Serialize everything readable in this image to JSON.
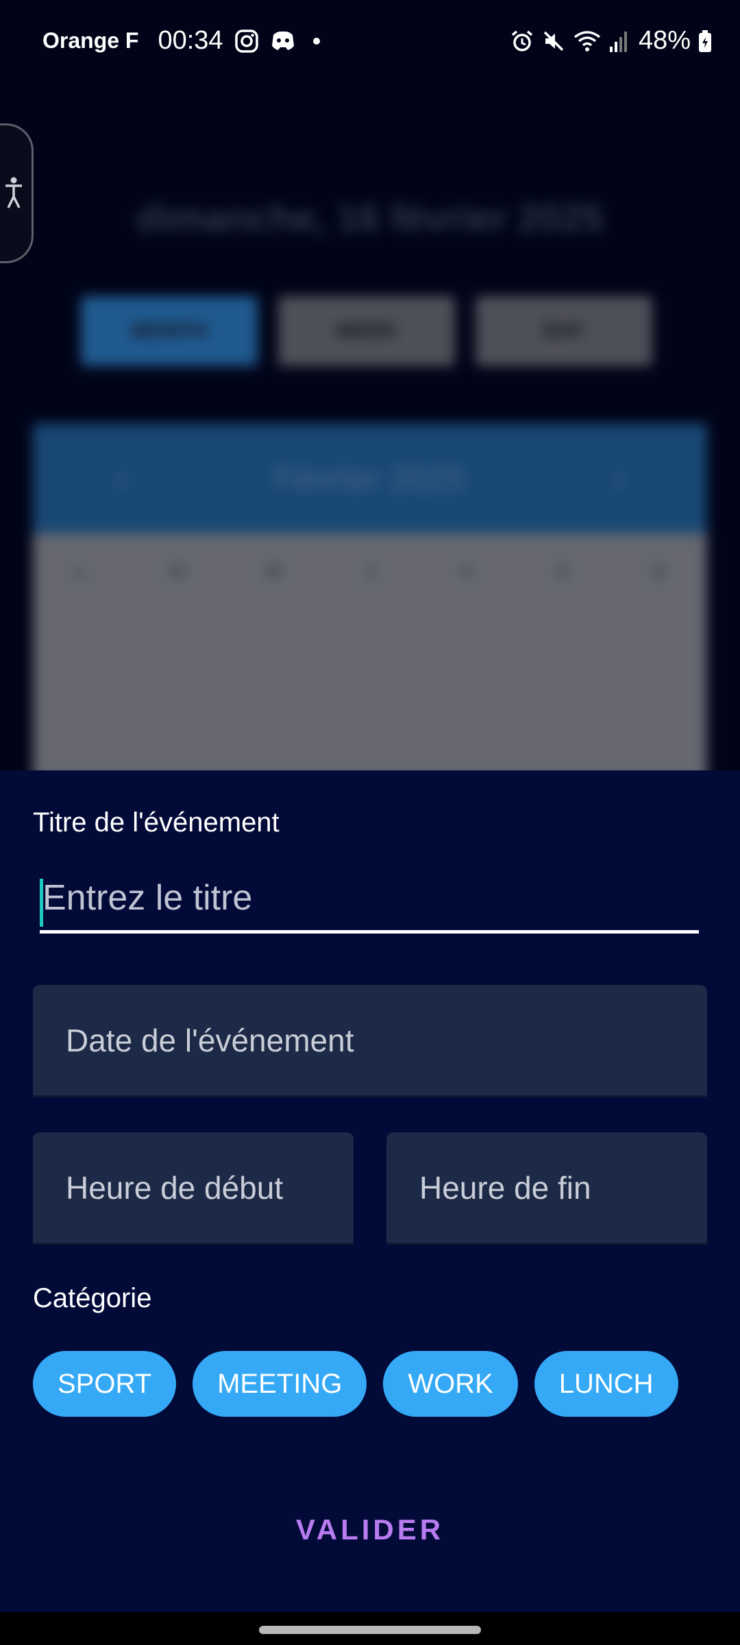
{
  "status_bar": {
    "carrier": "Orange F",
    "time": "00:34",
    "battery": "48%",
    "left_icons": [
      "instagram-icon",
      "discord-icon",
      "dot-icon"
    ],
    "right_icons": [
      "alarm-icon",
      "mute-icon",
      "wifi-icon",
      "signal-icon",
      "battery-icon"
    ]
  },
  "background": {
    "date_heading": "dimanche, 16 février 2025",
    "view_buttons": [
      "MONTH",
      "WEEK",
      "DAY"
    ],
    "month_label": "Février 2025",
    "weekdays": [
      "L",
      "M",
      "M",
      "J",
      "V",
      "S",
      "D"
    ]
  },
  "form": {
    "title_label": "Titre de l'événement",
    "title_placeholder": "Entrez le titre",
    "title_value": "",
    "date_placeholder": "Date de l'événement",
    "start_time_placeholder": "Heure de début",
    "end_time_placeholder": "Heure de fin",
    "category_label": "Catégorie",
    "categories": [
      "SPORT",
      "MEETING",
      "WORK",
      "LUNCH"
    ],
    "submit_label": "VALIDER"
  },
  "colors": {
    "sheet_background": "#020a38",
    "field_background": "#1c2a47",
    "chip": "#35a9f6",
    "submit": "#b97cf0",
    "caret": "#20c7c0"
  }
}
